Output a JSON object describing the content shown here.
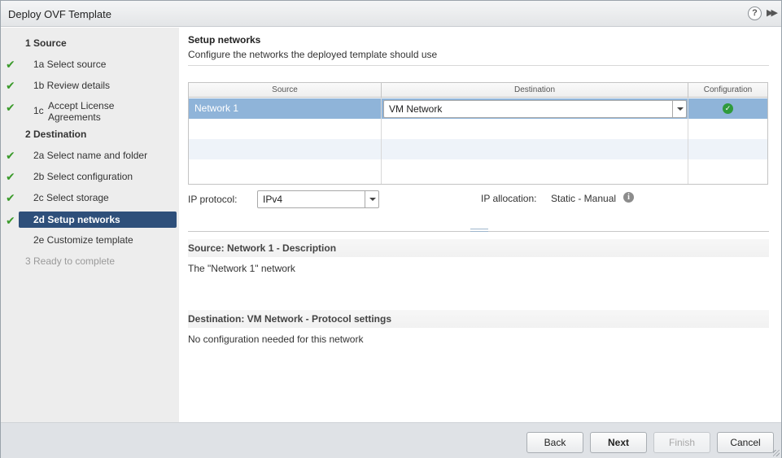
{
  "window": {
    "title": "Deploy OVF Template"
  },
  "nav": [
    {
      "label": "1  Source",
      "kind": "header",
      "checked": false
    },
    {
      "label": "1a  Select source",
      "kind": "sub",
      "checked": true
    },
    {
      "label": "1b  Review details",
      "kind": "sub",
      "checked": true
    },
    {
      "num": "1c",
      "label": "Accept License Agreements",
      "kind": "two-line",
      "checked": true
    },
    {
      "label": "2  Destination",
      "kind": "header",
      "checked": false
    },
    {
      "label": "2a  Select name and folder",
      "kind": "sub",
      "checked": true
    },
    {
      "label": "2b  Select configuration",
      "kind": "sub",
      "checked": true
    },
    {
      "label": "2c  Select storage",
      "kind": "sub",
      "checked": true
    },
    {
      "label": "2d  Setup networks",
      "kind": "sub",
      "checked": true,
      "active": true
    },
    {
      "label": "2e  Customize template",
      "kind": "sub",
      "checked": false
    },
    {
      "label": "3  Ready to complete",
      "kind": "header-disabled",
      "checked": false
    }
  ],
  "main": {
    "heading": "Setup networks",
    "subtitle": "Configure the networks the deployed template should use",
    "grid": {
      "columns": [
        "Source",
        "Destination",
        "Configuration"
      ],
      "rows": [
        {
          "source": "Network 1",
          "destination": "VM Network",
          "configuration": "ok"
        }
      ]
    },
    "ip_protocol": {
      "label": "IP protocol:",
      "value": "IPv4"
    },
    "ip_allocation": {
      "label": "IP allocation:",
      "value": "Static - Manual"
    },
    "source_section": {
      "title": "Source: Network 1 - Description",
      "body": "The \"Network 1\" network"
    },
    "dest_section": {
      "title": "Destination: VM Network - Protocol settings",
      "body": "No configuration needed for this network"
    }
  },
  "footer": {
    "back": "Back",
    "next": "Next",
    "finish": "Finish",
    "cancel": "Cancel"
  },
  "colors": {
    "accent": "#2e4f7a",
    "selected_row": "#8fb4d9",
    "check": "#3a9a2a"
  },
  "icons": {
    "help": "help-icon",
    "expand": "expand-icon",
    "check": "check-icon",
    "status_ok": "status-ok-icon",
    "info": "info-icon"
  }
}
